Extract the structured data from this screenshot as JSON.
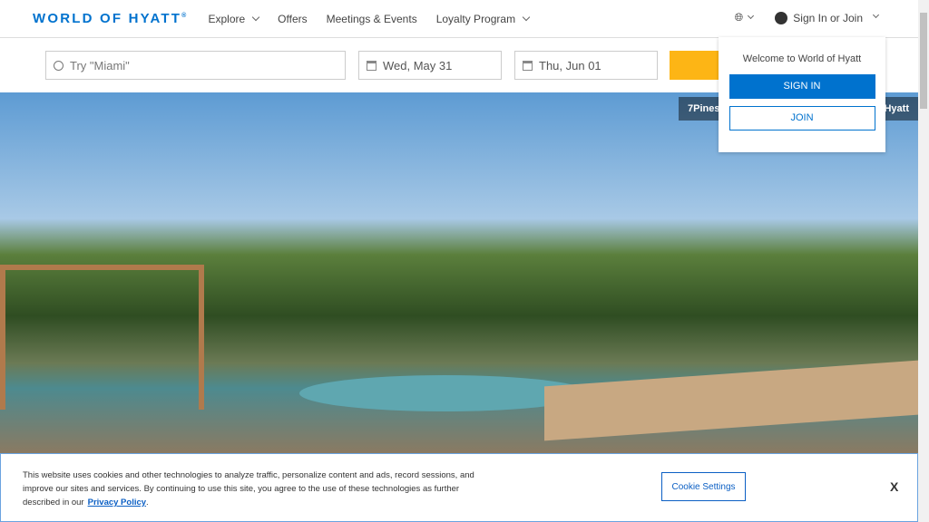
{
  "header": {
    "logo": "WORLD OF HYATT",
    "nav": [
      {
        "label": "Explore"
      },
      {
        "label": "Offers"
      },
      {
        "label": "Meetings & Events"
      },
      {
        "label": "Loyalty Program"
      }
    ],
    "sign_in": "Sign In or Join"
  },
  "search": {
    "destination_placeholder": "Try \"Miami\"",
    "check_in": "Wed, May 31",
    "check_out": "Thu, Jun 01"
  },
  "hero": {
    "caption_left": "7Pines",
    "caption_right": "Hyatt"
  },
  "dropdown": {
    "welcome": "Welcome to World of Hyatt",
    "sign_in": "SIGN IN",
    "join": "JOIN"
  },
  "cookie": {
    "text": "This website uses cookies and other technologies to analyze traffic, personalize content and ads, record sessions, and improve our sites and services. By continuing to use this site, you agree to the use of these technologies as further described in our",
    "policy": "Privacy Policy",
    "settings": "Cookie Settings",
    "close": "X"
  },
  "colors": {
    "brand": "#0072ce",
    "search_button": "#fdb515"
  }
}
